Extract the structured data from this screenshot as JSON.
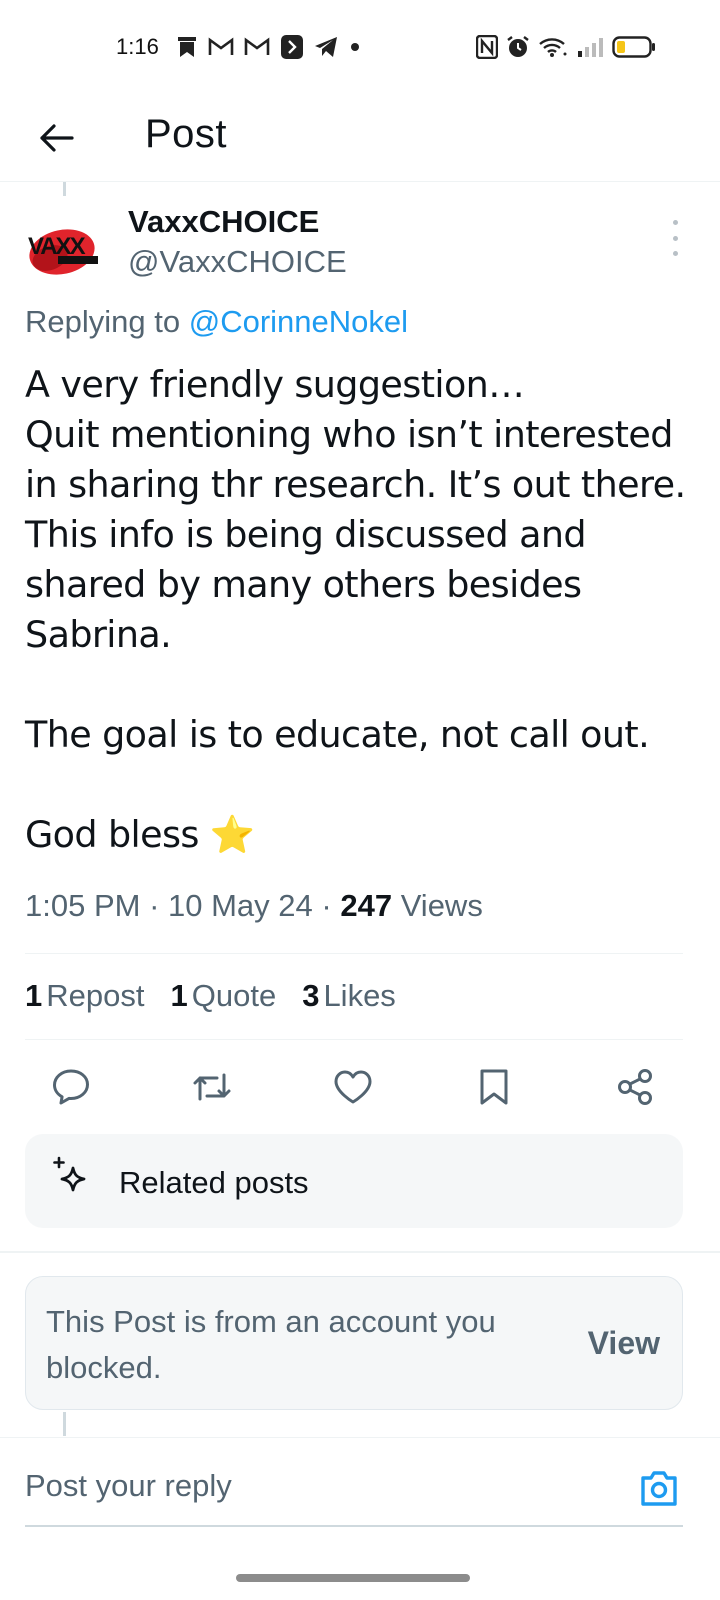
{
  "status_bar": {
    "time": "1:16",
    "left_icons": [
      "bookmark-notification-icon",
      "gmail-icon",
      "gmail-icon",
      "app-notification-icon",
      "telegram-icon",
      "dot-icon"
    ],
    "right_icons": [
      "nfc-icon",
      "alarm-icon",
      "wifi-icon",
      "signal-icon",
      "battery-icon"
    ]
  },
  "header": {
    "title": "Post"
  },
  "post": {
    "author_name": "VaxxCHOICE",
    "author_handle": "@VaxxCHOICE",
    "avatar_text": "VAXX",
    "replying_prefix": "Replying to ",
    "replying_to": "@CorinneNokel",
    "body": "A very friendly suggestion…\nQuit mentioning who isn’t interested in sharing thr research. It’s out there. This info is being discussed and shared by many others besides Sabrina.\n\nThe goal is to educate, not call out.\n\nGod bless ⭐",
    "time": "1:05 PM",
    "date": "10 May 24",
    "separator": " · ",
    "views_count": "247",
    "views_label": " Views"
  },
  "stats": {
    "reposts_count": "1",
    "reposts_label": "Repost",
    "quotes_count": "1",
    "quotes_label": "Quote",
    "likes_count": "3",
    "likes_label": "Likes"
  },
  "actions": [
    "reply-icon",
    "repost-icon",
    "like-icon",
    "bookmark-icon",
    "share-icon"
  ],
  "related": {
    "label": "Related posts"
  },
  "blocked_notice": {
    "text": "This Post is from an account you blocked.",
    "button": "View"
  },
  "reply": {
    "placeholder": "Post your reply"
  },
  "colors": {
    "link": "#1d9bf0",
    "secondary_text": "#536471",
    "primary_text": "#0f1419",
    "card_bg": "#f5f7f8"
  }
}
